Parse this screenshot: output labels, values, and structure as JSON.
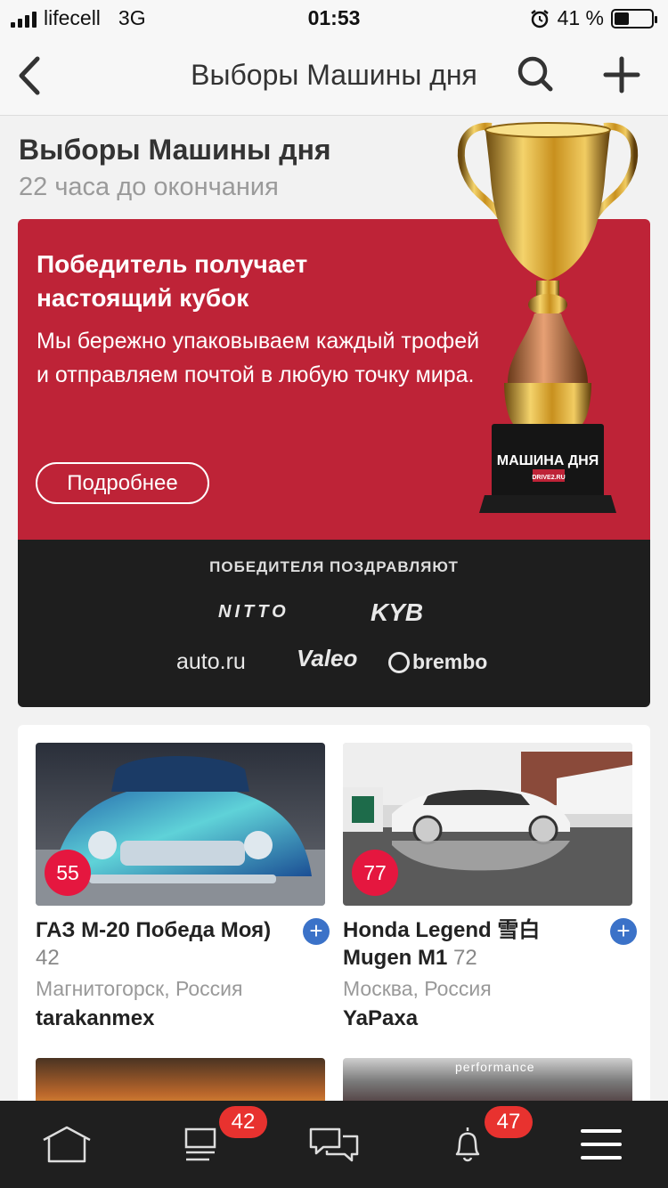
{
  "status_bar": {
    "carrier": "lifecell",
    "network": "3G",
    "time": "01:53",
    "battery_percent": "41 %",
    "battery_level": 0.41
  },
  "nav": {
    "title": "Выборы Машины дня",
    "icons": [
      "back-arrow-icon",
      "search-icon",
      "plus-icon"
    ]
  },
  "header": {
    "title": "Выборы Машины дня",
    "subtitle": "22 часа до окончания"
  },
  "promo": {
    "title": "Победитель получает настоящий кубок",
    "text": "Мы бережно упаковываем каждый трофей и отправляем почтой в любую точку мира.",
    "button": "Подробнее",
    "trophy_plate_title": "МАШИНА ДНЯ",
    "trophy_plate_sub": "DRIVE2.RU",
    "bg_color": "#be2337"
  },
  "sponsors": {
    "title": "ПОБЕДИТЕЛЯ ПОЗДРАВЛЯЮТ",
    "logos": [
      "NITTO",
      "KYB",
      "auto.ru",
      "Valeo",
      "brembo"
    ]
  },
  "cards": [
    {
      "score": "55",
      "title": "ГАЗ М-20 Победа Моя)",
      "count": "42",
      "city": "Магнитогорск, Россия",
      "user": "tarakanmex"
    },
    {
      "score": "77",
      "title": "Honda Legend 雪白 Mugen M1",
      "count": "72",
      "city": "Москва, Россия",
      "user": "YaPaxa"
    }
  ],
  "next_card_text": "performance",
  "tab_bar": {
    "items": [
      {
        "icon": "home-icon"
      },
      {
        "icon": "feed-icon",
        "badge": "42"
      },
      {
        "icon": "messages-icon"
      },
      {
        "icon": "bell-icon",
        "badge": "47"
      },
      {
        "icon": "menu-icon"
      }
    ]
  },
  "colors": {
    "accent_red": "#be2337",
    "score_red": "#e5173f",
    "follow_blue": "#3b72c8",
    "badge_red": "#e8322f"
  }
}
